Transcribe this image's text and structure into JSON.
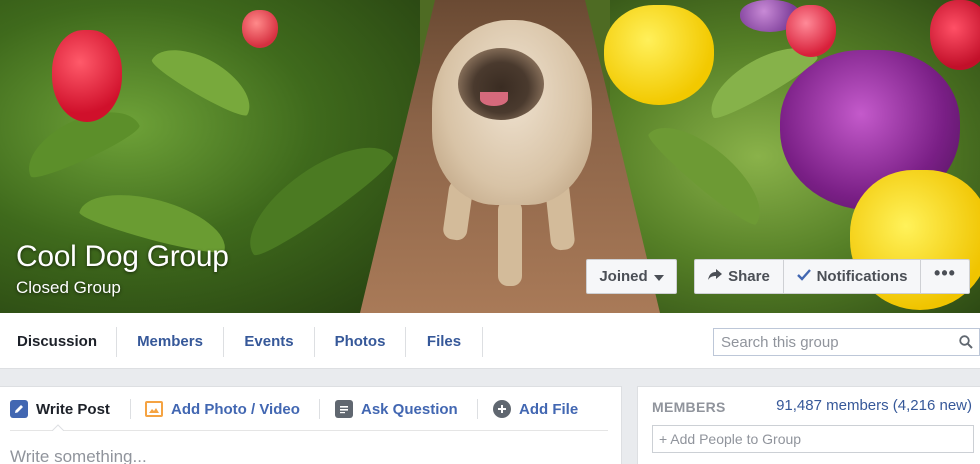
{
  "group": {
    "name": "Cool Dog Group",
    "privacy": "Closed Group"
  },
  "actions": {
    "joined_label": "Joined",
    "share_label": "Share",
    "notifications_label": "Notifications",
    "more_label": "•••"
  },
  "tabs": [
    {
      "label": "Discussion"
    },
    {
      "label": "Members"
    },
    {
      "label": "Events"
    },
    {
      "label": "Photos"
    },
    {
      "label": "Files"
    }
  ],
  "search": {
    "placeholder": "Search this group"
  },
  "composer": {
    "tabs": [
      {
        "label": "Write Post",
        "icon": "pencil-icon"
      },
      {
        "label": "Add Photo / Video",
        "icon": "photo-icon"
      },
      {
        "label": "Ask Question",
        "icon": "question-list-icon"
      },
      {
        "label": "Add File",
        "icon": "add-file-icon"
      }
    ],
    "placeholder": "Write something..."
  },
  "members_panel": {
    "label": "MEMBERS",
    "count": "91,487 members (4,216 new)",
    "add_placeholder": "+ Add People to Group"
  },
  "colors": {
    "link": "#365899",
    "accent": "#4267b2",
    "text": "#1d2129",
    "muted": "#90949c"
  }
}
